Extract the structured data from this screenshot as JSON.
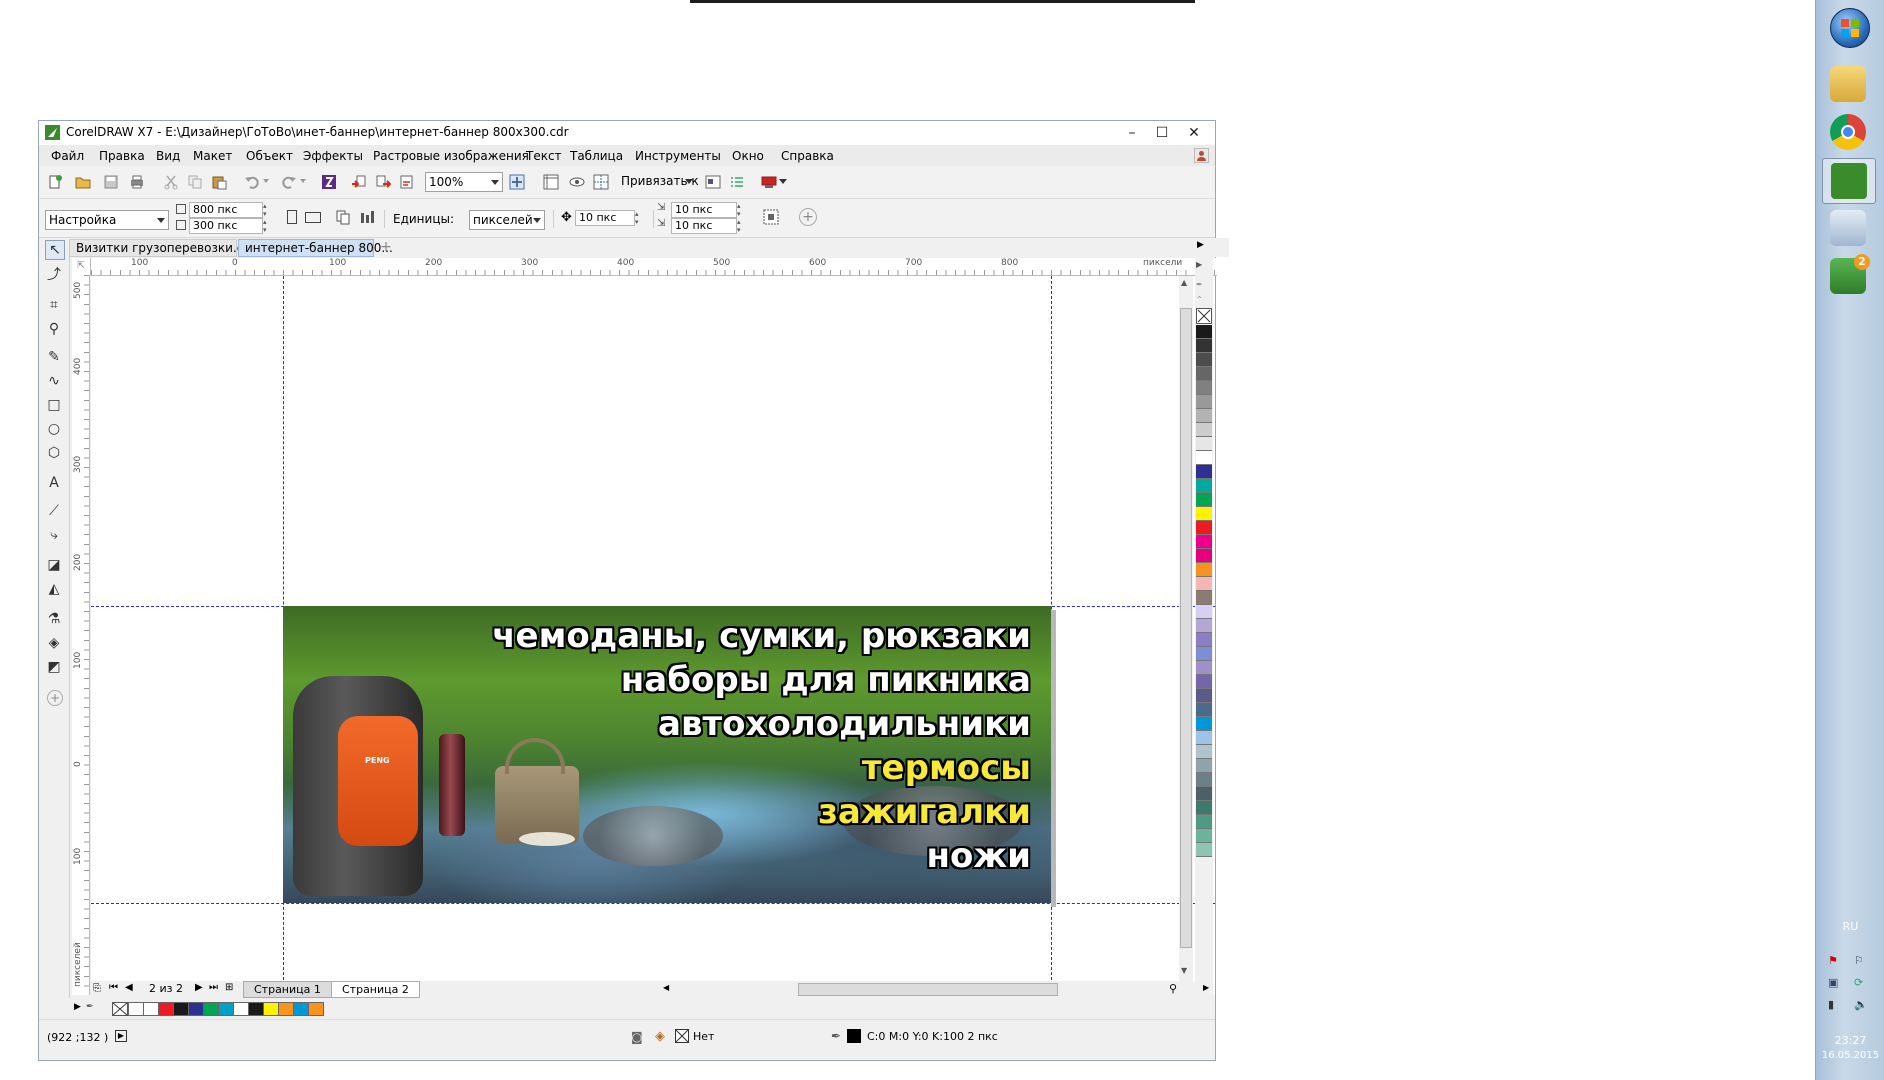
{
  "window": {
    "title": "CorelDRAW X7 - E:\\Дизайнер\\ГоТоВо\\инет-баннер\\интернет-баннер 800x300.cdr",
    "minimize": "–",
    "maximize": "☐",
    "close": "✕"
  },
  "menu": [
    "Файл",
    "Правка",
    "Вид",
    "Макет",
    "Объект",
    "Эффекты",
    "Растровые изображения",
    "Текст",
    "Таблица",
    "Инструменты",
    "Окно",
    "Справка"
  ],
  "toolbar": {
    "zoom": "100%",
    "snap_label": "Привязать к"
  },
  "propbar": {
    "preset": "Настройка",
    "width": "800 пкс",
    "height": "300 пкс",
    "units_label": "Единицы:",
    "units_value": "пикселей",
    "nudge": "10 пкс",
    "dup_x": "10 пкс",
    "dup_y": "10 пкс"
  },
  "tabs": [
    "Визитки грузоперевозки.cdr",
    "интернет-баннер 800..."
  ],
  "ruler": {
    "h_ticks": [
      "100",
      "0",
      "100",
      "200",
      "300",
      "400",
      "500",
      "600",
      "700",
      "800"
    ],
    "h_unit": "пиксели",
    "v_ticks": [
      "500",
      "400",
      "300",
      "200",
      "100",
      "0",
      "100"
    ],
    "v_unit": "пикселей"
  },
  "banner": {
    "lines": [
      "чемоданы, сумки, рюкзаки",
      "наборы для пикника",
      "автохолодильники",
      "термосы",
      "зажигалки",
      "ножи"
    ],
    "product_brand": "PENG"
  },
  "pages": {
    "counter": "2 из 2",
    "page1": "Страница 1",
    "page2": "Страница 2"
  },
  "palette_colors": [
    "#1a1a1a",
    "#333333",
    "#4d4d4d",
    "#666666",
    "#808080",
    "#999999",
    "#b3b3b3",
    "#cccccc",
    "#e6e6e6",
    "#ffffff",
    "#2e3192",
    "#00a99d",
    "#00a651",
    "#fff200",
    "#ed1c24",
    "#ec008c",
    "#e6007e",
    "#f7941d",
    "#f5b5b5",
    "#8c7b75",
    "#d7d0f0",
    "#b4a7d6",
    "#8c7dc8",
    "#7b8ed6",
    "#9e91c9",
    "#7466a8",
    "#5c5a88",
    "#4c6a8c",
    "#0098d8",
    "#9dc3e6",
    "#b0c4ce",
    "#8fa3ad",
    "#6d8088",
    "#4d6066",
    "#3d7a6c",
    "#4e9a84",
    "#6cb39b",
    "#8dc6b0"
  ],
  "doc_palette": [
    "#ffffff",
    "#ffffff",
    "#ed1c24",
    "#1a1a1a",
    "#2e3192",
    "#00a651",
    "#00a0c6",
    "#ffffff",
    "#1a1a1a",
    "#fff200",
    "#f7941d",
    "#0098d8",
    "#f7941d"
  ],
  "status": {
    "coords": "(922 ;132 )",
    "fill_none": "Нет",
    "outline": "C:0 M:0 Y:0 K:100  2 пкс"
  },
  "taskbar": {
    "lang": "RU",
    "time": "23:27",
    "date": "16.05.2015",
    "badge": "2"
  }
}
